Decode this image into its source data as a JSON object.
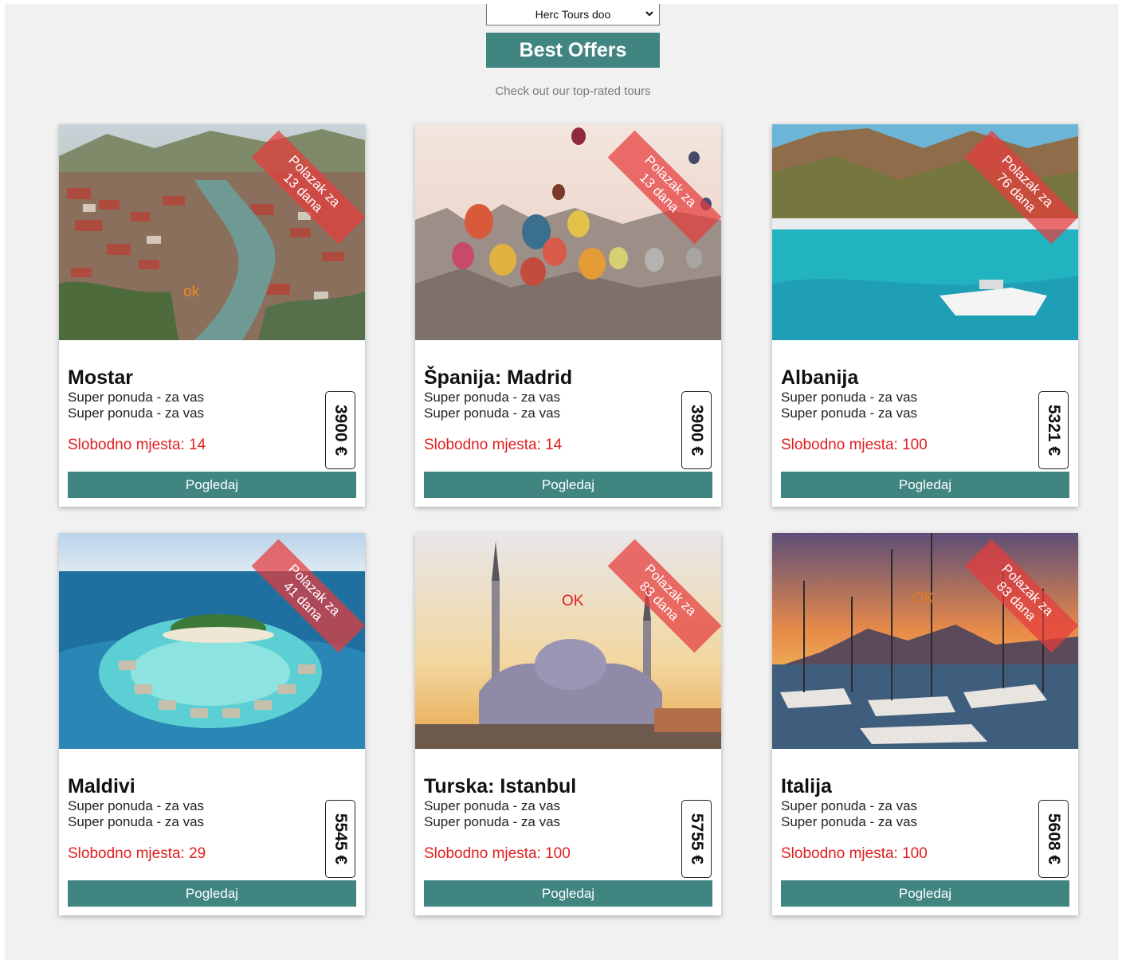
{
  "agency_select": {
    "selected": "Herc Tours doo",
    "icon": "chevron-down-icon"
  },
  "header": {
    "title": "Best Offers",
    "subtitle": "Check out our top-rated tours"
  },
  "colors": {
    "accent": "#418581",
    "seats": "#e02020",
    "ribbon": "#e63c3c",
    "background": "#f1f1f1"
  },
  "tours": [
    {
      "name": "Mostar",
      "line1": "Super ponuda - za vas",
      "line2": "Super ponuda - za vas",
      "seats": "Slobodno mjesta: 14",
      "price": "3900 €",
      "ribbon_line1": "Polazak za",
      "ribbon_line2": "13 dana",
      "ok_label": "ok",
      "button": "Pogledaj",
      "image": "city-river-photo"
    },
    {
      "name": "Španija: Madrid",
      "line1": "Super ponuda - za vas",
      "line2": "Super ponuda - za vas",
      "seats": "Slobodno mjesta: 14",
      "price": "3900 €",
      "ribbon_line1": "Polazak za",
      "ribbon_line2": "13 dana",
      "ok_label": "",
      "button": "Pogledaj",
      "image": "hot-air-balloons-photo"
    },
    {
      "name": "Albanija",
      "line1": "Super ponuda - za vas",
      "line2": "Super ponuda - za vas",
      "seats": "Slobodno mjesta: 100",
      "price": "5321 €",
      "ribbon_line1": "Polazak za",
      "ribbon_line2": "76 dana",
      "ok_label": "",
      "button": "Pogledaj",
      "image": "coastal-bay-photo"
    },
    {
      "name": "Maldivi",
      "line1": "Super ponuda - za vas",
      "line2": "Super ponuda - za vas",
      "seats": "Slobodno mjesta: 29",
      "price": "5545 €",
      "ribbon_line1": "Polazak za",
      "ribbon_line2": "41 dana",
      "ok_label": "",
      "button": "Pogledaj",
      "image": "island-resort-photo"
    },
    {
      "name": "Turska: Istanbul",
      "line1": "Super ponuda - za vas",
      "line2": "Super ponuda - za vas",
      "seats": "Slobodno mjesta: 100",
      "price": "5755 €",
      "ribbon_line1": "Polazak za",
      "ribbon_line2": "83 dana",
      "ok_label": "OK",
      "button": "Pogledaj",
      "image": "mosque-photo"
    },
    {
      "name": "Italija",
      "line1": "Super ponuda - za vas",
      "line2": "Super ponuda - za vas",
      "seats": "Slobodno mjesta: 100",
      "price": "5608 €",
      "ribbon_line1": "Polazak za",
      "ribbon_line2": "83 dana",
      "ok_label": "OK",
      "button": "Pogledaj",
      "image": "harbor-sunset-photo"
    }
  ]
}
